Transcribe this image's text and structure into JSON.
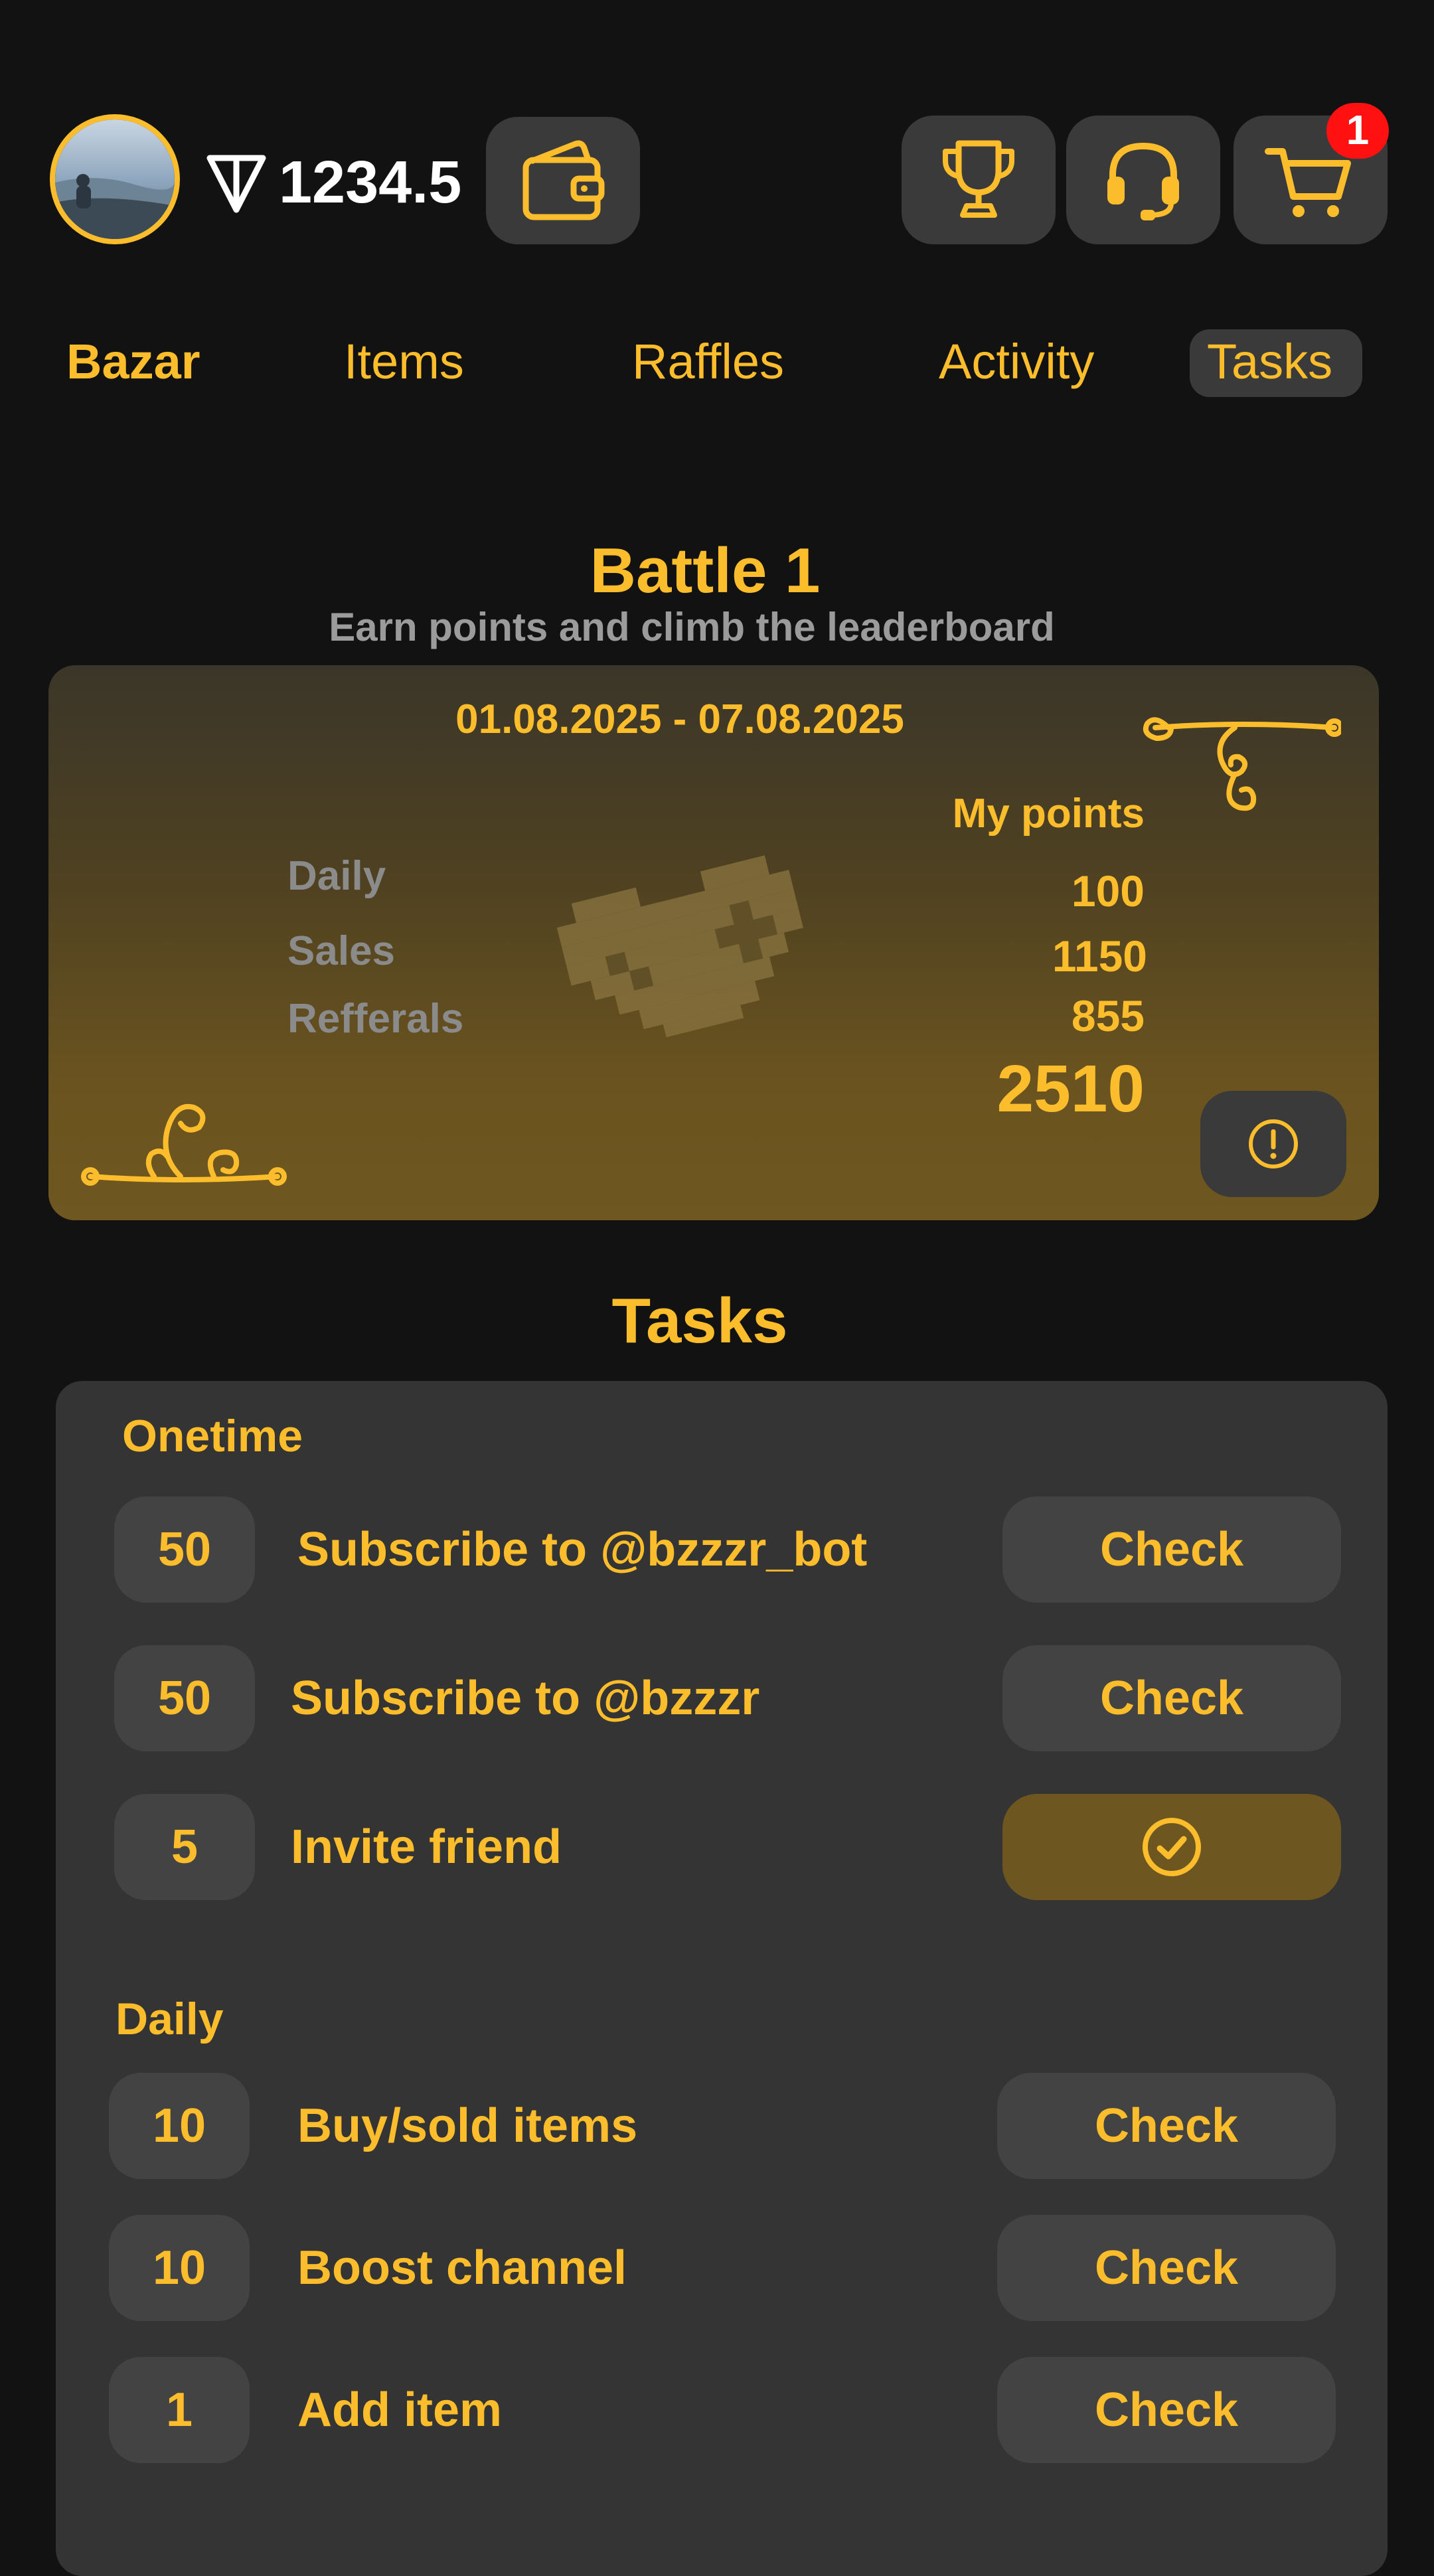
{
  "colors": {
    "accent": "#fbbd2b",
    "background": "#121212",
    "panel": "#343434",
    "button": "#434343",
    "badge": "#ff1111"
  },
  "header": {
    "balance": "1234.5",
    "balance_icon": "ton-icon",
    "wallet_icon": "wallet-icon",
    "buttons": [
      "trophy-icon",
      "headset-icon",
      "cart-icon"
    ],
    "cart_badge": "1"
  },
  "tabs": [
    {
      "label": "Bazar"
    },
    {
      "label": "Items"
    },
    {
      "label": "Raffles"
    },
    {
      "label": "Activity"
    },
    {
      "label": "Tasks",
      "active": true
    }
  ],
  "battle": {
    "title": "Battle 1",
    "subtitle": "Earn points and climb the leaderboard",
    "dates": "01.08.2025 - 07.08.2025",
    "points_header": "My points",
    "rows": [
      {
        "label": "Daily",
        "value": "100"
      },
      {
        "label": "Sales",
        "value": "1150"
      },
      {
        "label": "Refferals",
        "value": "855"
      }
    ],
    "total": "2510",
    "info_icon": "info-icon"
  },
  "tasks": {
    "title": "Tasks",
    "onetime": {
      "label": "Onetime",
      "items": [
        {
          "points": "50",
          "label": "Subscribe to @bzzzr_bot",
          "action": "Check"
        },
        {
          "points": "50",
          "label": "Subscribe to @bzzzr",
          "action": "Check"
        },
        {
          "points": "5",
          "label": "Invite friend",
          "action_icon": "check-circle-icon",
          "done": true
        }
      ]
    },
    "daily": {
      "label": "Daily",
      "items": [
        {
          "points": "10",
          "label": "Buy/sold items",
          "action": "Check"
        },
        {
          "points": "10",
          "label": "Boost channel",
          "action": "Check"
        },
        {
          "points": "1",
          "label": "Add item",
          "action": "Check"
        }
      ]
    }
  }
}
